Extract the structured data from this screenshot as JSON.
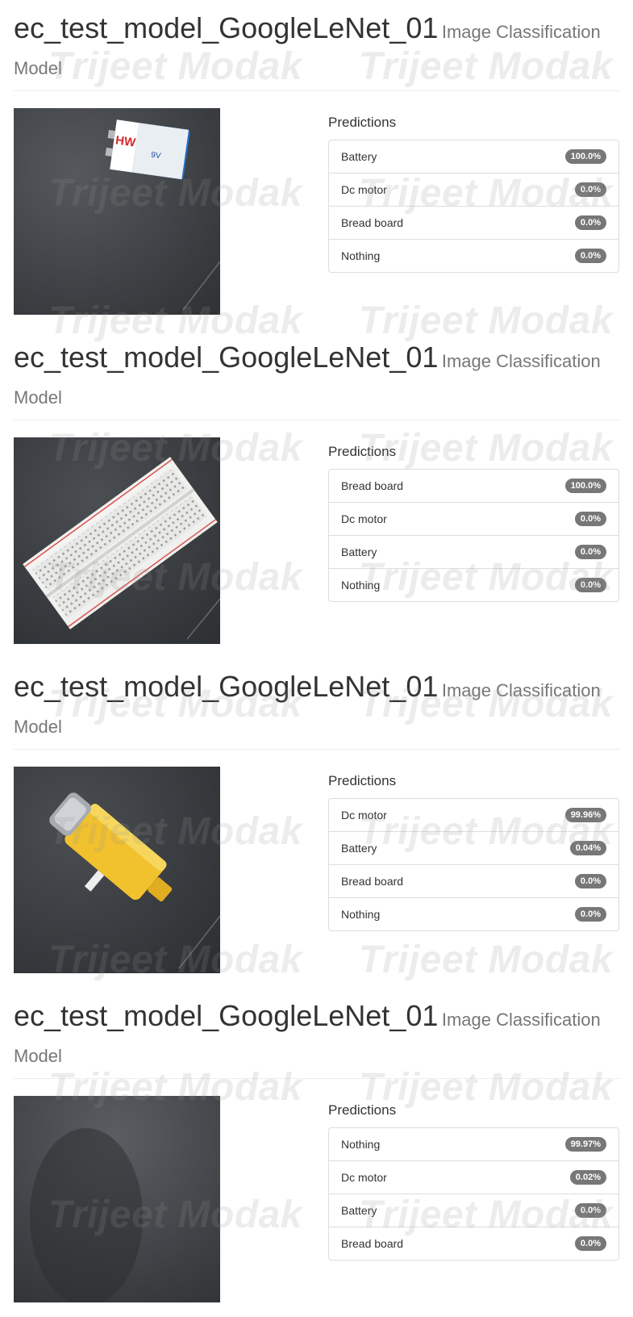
{
  "sections": [
    {
      "title": "ec_test_model_GoogleLeNet_01",
      "subtitle": "Image Classification Model",
      "predictions_label": "Predictions",
      "image_subject": "battery",
      "predictions": [
        {
          "label": "Battery",
          "value": "100.0%"
        },
        {
          "label": "Dc motor",
          "value": "0.0%"
        },
        {
          "label": "Bread board",
          "value": "0.0%"
        },
        {
          "label": "Nothing",
          "value": "0.0%"
        }
      ]
    },
    {
      "title": "ec_test_model_GoogleLeNet_01",
      "subtitle": "Image Classification Model",
      "predictions_label": "Predictions",
      "image_subject": "breadboard",
      "predictions": [
        {
          "label": "Bread board",
          "value": "100.0%"
        },
        {
          "label": "Dc motor",
          "value": "0.0%"
        },
        {
          "label": "Battery",
          "value": "0.0%"
        },
        {
          "label": "Nothing",
          "value": "0.0%"
        }
      ]
    },
    {
      "title": "ec_test_model_GoogleLeNet_01",
      "subtitle": "Image Classification Model",
      "predictions_label": "Predictions",
      "image_subject": "dc-motor",
      "predictions": [
        {
          "label": "Dc motor",
          "value": "99.96%"
        },
        {
          "label": "Battery",
          "value": "0.04%"
        },
        {
          "label": "Bread board",
          "value": "0.0%"
        },
        {
          "label": "Nothing",
          "value": "0.0%"
        }
      ]
    },
    {
      "title": "ec_test_model_GoogleLeNet_01",
      "subtitle": "Image Classification Model",
      "predictions_label": "Predictions",
      "image_subject": "empty-surface",
      "predictions": [
        {
          "label": "Nothing",
          "value": "99.97%"
        },
        {
          "label": "Dc motor",
          "value": "0.02%"
        },
        {
          "label": "Battery",
          "value": "0.0%"
        },
        {
          "label": "Bread board",
          "value": "0.0%"
        }
      ]
    }
  ],
  "watermark": {
    "text": "Trijeet Modak",
    "color": "#969696"
  },
  "colors": {
    "badge_bg": "#777777",
    "subtitle": "#777777",
    "title": "#333333",
    "border": "#dddddd"
  },
  "image_labels": {
    "battery_top": "HW",
    "battery_side": "9V"
  }
}
